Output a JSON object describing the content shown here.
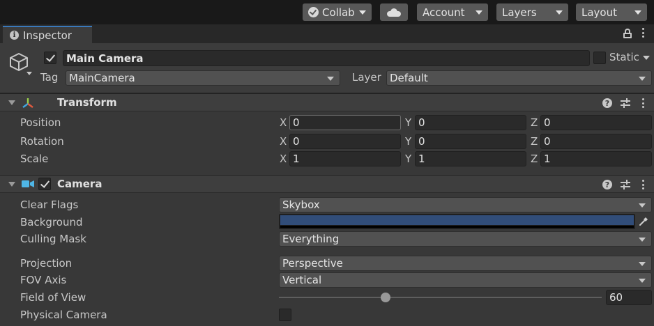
{
  "toolbar": {
    "collab_label": "Collab",
    "account_label": "Account",
    "layers_label": "Layers",
    "layout_label": "Layout"
  },
  "tab": {
    "label": "Inspector"
  },
  "object": {
    "active": true,
    "name": "Main Camera",
    "static_label": "Static",
    "static_checked": false,
    "tag_label": "Tag",
    "tag_value": "MainCamera",
    "layer_label": "Layer",
    "layer_value": "Default"
  },
  "transform": {
    "title": "Transform",
    "position_label": "Position",
    "rotation_label": "Rotation",
    "scale_label": "Scale",
    "position": {
      "x": "0",
      "y": "0",
      "z": "0"
    },
    "rotation": {
      "x": "0",
      "y": "0",
      "z": "0"
    },
    "scale": {
      "x": "1",
      "y": "1",
      "z": "1"
    },
    "axis_x": "X",
    "axis_y": "Y",
    "axis_z": "Z"
  },
  "camera": {
    "title": "Camera",
    "enabled": true,
    "clear_flags_label": "Clear Flags",
    "clear_flags_value": "Skybox",
    "background_label": "Background",
    "background_color": "#314d79",
    "culling_mask_label": "Culling Mask",
    "culling_mask_value": "Everything",
    "projection_label": "Projection",
    "projection_value": "Perspective",
    "fov_axis_label": "FOV Axis",
    "fov_axis_value": "Vertical",
    "fov_label": "Field of View",
    "fov_value": "60",
    "fov_min": 1,
    "fov_max": 179,
    "physical_camera_label": "Physical Camera",
    "physical_camera_checked": false
  },
  "colors": {
    "accent": "#3a79bb",
    "panel": "#383838",
    "toolbar": "#191919"
  }
}
